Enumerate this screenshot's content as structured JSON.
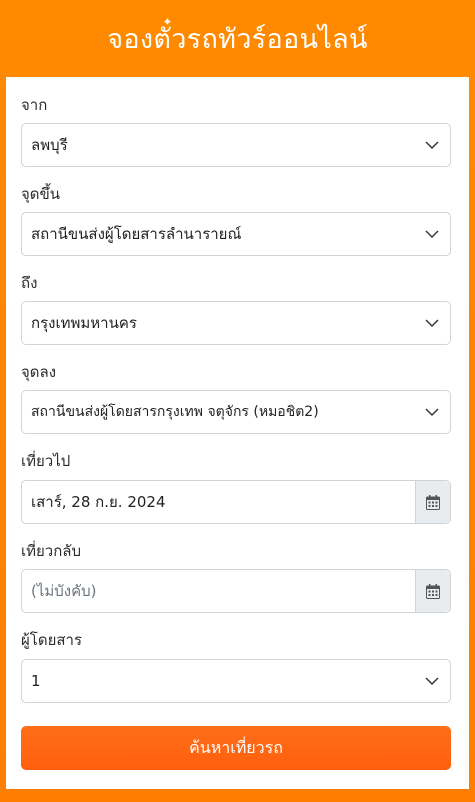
{
  "header": {
    "title": "จองตั๋วรถทัวร์ออนไลน์"
  },
  "form": {
    "origin": {
      "label": "จาก",
      "value": "ลพบุรี",
      "icon": "chevron-down-icon"
    },
    "pickup": {
      "label": "จุดขึ้น",
      "value": "สถานีขนส่งผู้โดยสารลำนารายณ์",
      "icon": "chevron-down-icon"
    },
    "destination": {
      "label": "ถึง",
      "value": "กรุงเทพมหานคร",
      "icon": "chevron-down-icon"
    },
    "dropoff": {
      "label": "จุดลง",
      "value": "สถานีขนส่งผู้โดยสารกรุงเทพ จตุจักร (หมอชิต2)",
      "icon": "chevron-down-icon"
    },
    "depart": {
      "label": "เที่ยวไป",
      "value": "เสาร์, 28 ก.ย. 2024",
      "icon": "calendar-icon"
    },
    "return": {
      "label": "เที่ยวกลับ",
      "placeholder": "(ไม่บังคับ)",
      "icon": "calendar-icon"
    },
    "passengers": {
      "label": "ผู้โดยสาร",
      "value": "1",
      "icon": "chevron-down-icon"
    },
    "search_button": "ค้นหาเที่ยวรถ"
  },
  "colors": {
    "background": "#ff8a00",
    "button": "#ff6410",
    "border": "#cfd4d9",
    "addon": "#e9ecef"
  }
}
